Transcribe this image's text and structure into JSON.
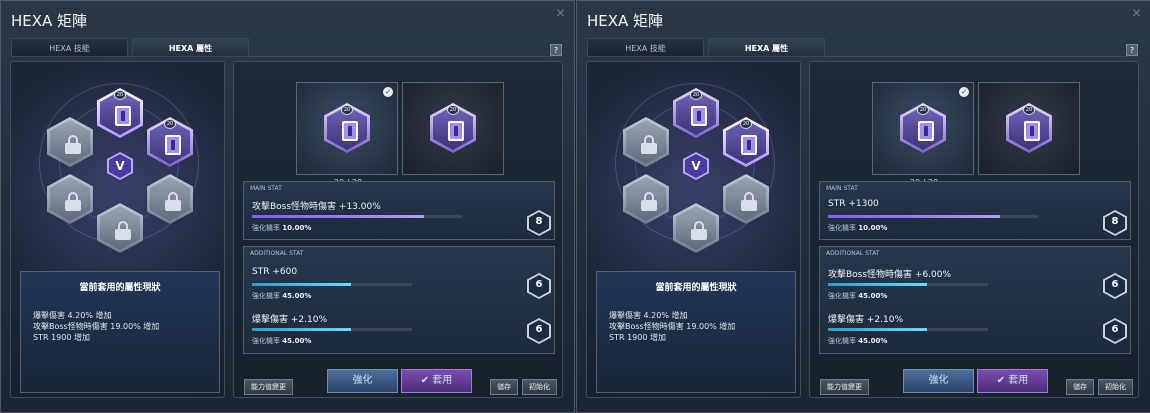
{
  "windows": [
    {
      "title": "HEXA 矩陣",
      "tabs": [
        "HEXA 技能",
        "HEXA 屬性"
      ],
      "help": "?",
      "close": "×",
      "core_badge": "20",
      "core_level": "V",
      "cards": [
        {
          "badge": "20",
          "value": "20 / 20",
          "checked": true,
          "active": true
        },
        {
          "badge": "20",
          "value": "",
          "checked": false,
          "active": false
        }
      ],
      "main": {
        "label": "MAIN STAT",
        "stat": "攻擊Boss怪物時傷害 +13.00%",
        "rate_label": "強化機率",
        "rate": "10.00%",
        "level": "8",
        "progress": 0.82
      },
      "additional_label": "ADDITIONAL STAT",
      "adds": [
        {
          "stat": "STR +600",
          "rate_label": "強化機率",
          "rate": "45.00%",
          "level": "6",
          "progress": 0.62
        },
        {
          "stat": "爆擊傷害 +2.10%",
          "rate_label": "強化機率",
          "rate": "45.00%",
          "level": "6",
          "progress": 0.62
        }
      ],
      "status": {
        "title": "當前套用的屬性現狀",
        "lines": [
          "爆擊傷害 4.20% 增加",
          "攻擊Boss怪物時傷害 19.00% 增加",
          "STR 1900 增加"
        ]
      },
      "buttons": {
        "change": "能力值變更",
        "enhance": "強化",
        "apply": "套用",
        "save": "儲存",
        "reset": "初始化"
      }
    },
    {
      "title": "HEXA 矩陣",
      "tabs": [
        "HEXA 技能",
        "HEXA 屬性"
      ],
      "help": "?",
      "close": "×",
      "core_badge": "20",
      "core_level": "V",
      "cards": [
        {
          "badge": "20",
          "value": "20 / 20",
          "checked": true,
          "active": true
        },
        {
          "badge": "20",
          "value": "",
          "checked": false,
          "active": false
        }
      ],
      "main": {
        "label": "MAIN STAT",
        "stat": "STR +1300",
        "rate_label": "強化機率",
        "rate": "10.00%",
        "level": "8",
        "progress": 0.82
      },
      "additional_label": "ADDITIONAL STAT",
      "adds": [
        {
          "stat": "攻擊Boss怪物時傷害 +6.00%",
          "rate_label": "強化機率",
          "rate": "45.00%",
          "level": "6",
          "progress": 0.62
        },
        {
          "stat": "爆擊傷害 +2.10%",
          "rate_label": "強化機率",
          "rate": "45.00%",
          "level": "6",
          "progress": 0.62
        }
      ],
      "status": {
        "title": "當前套用的屬性現狀",
        "lines": [
          "爆擊傷害 4.20% 增加",
          "攻擊Boss怪物時傷害 19.00% 增加",
          "STR 1900 增加"
        ]
      },
      "buttons": {
        "change": "能力值變更",
        "enhance": "強化",
        "apply": "套用",
        "save": "儲存",
        "reset": "初始化"
      }
    }
  ]
}
